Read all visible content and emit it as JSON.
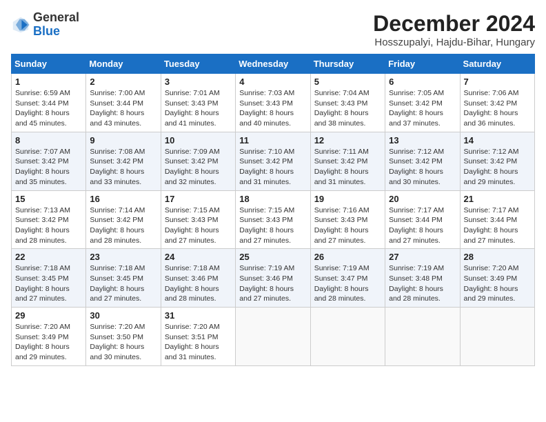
{
  "header": {
    "logo_general": "General",
    "logo_blue": "Blue",
    "main_title": "December 2024",
    "subtitle": "Hosszupalyi, Hajdu-Bihar, Hungary"
  },
  "calendar": {
    "days_of_week": [
      "Sunday",
      "Monday",
      "Tuesday",
      "Wednesday",
      "Thursday",
      "Friday",
      "Saturday"
    ],
    "weeks": [
      [
        null,
        {
          "day": "1",
          "sunrise": "6:59 AM",
          "sunset": "3:44 PM",
          "daylight": "8 hours and 45 minutes."
        },
        {
          "day": "2",
          "sunrise": "7:00 AM",
          "sunset": "3:44 PM",
          "daylight": "8 hours and 43 minutes."
        },
        {
          "day": "3",
          "sunrise": "7:01 AM",
          "sunset": "3:43 PM",
          "daylight": "8 hours and 41 minutes."
        },
        {
          "day": "4",
          "sunrise": "7:03 AM",
          "sunset": "3:43 PM",
          "daylight": "8 hours and 40 minutes."
        },
        {
          "day": "5",
          "sunrise": "7:04 AM",
          "sunset": "3:43 PM",
          "daylight": "8 hours and 38 minutes."
        },
        {
          "day": "6",
          "sunrise": "7:05 AM",
          "sunset": "3:42 PM",
          "daylight": "8 hours and 37 minutes."
        },
        {
          "day": "7",
          "sunrise": "7:06 AM",
          "sunset": "3:42 PM",
          "daylight": "8 hours and 36 minutes."
        }
      ],
      [
        {
          "day": "8",
          "sunrise": "7:07 AM",
          "sunset": "3:42 PM",
          "daylight": "8 hours and 35 minutes."
        },
        {
          "day": "9",
          "sunrise": "7:08 AM",
          "sunset": "3:42 PM",
          "daylight": "8 hours and 33 minutes."
        },
        {
          "day": "10",
          "sunrise": "7:09 AM",
          "sunset": "3:42 PM",
          "daylight": "8 hours and 32 minutes."
        },
        {
          "day": "11",
          "sunrise": "7:10 AM",
          "sunset": "3:42 PM",
          "daylight": "8 hours and 31 minutes."
        },
        {
          "day": "12",
          "sunrise": "7:11 AM",
          "sunset": "3:42 PM",
          "daylight": "8 hours and 31 minutes."
        },
        {
          "day": "13",
          "sunrise": "7:12 AM",
          "sunset": "3:42 PM",
          "daylight": "8 hours and 30 minutes."
        },
        {
          "day": "14",
          "sunrise": "7:12 AM",
          "sunset": "3:42 PM",
          "daylight": "8 hours and 29 minutes."
        }
      ],
      [
        {
          "day": "15",
          "sunrise": "7:13 AM",
          "sunset": "3:42 PM",
          "daylight": "8 hours and 28 minutes."
        },
        {
          "day": "16",
          "sunrise": "7:14 AM",
          "sunset": "3:42 PM",
          "daylight": "8 hours and 28 minutes."
        },
        {
          "day": "17",
          "sunrise": "7:15 AM",
          "sunset": "3:43 PM",
          "daylight": "8 hours and 27 minutes."
        },
        {
          "day": "18",
          "sunrise": "7:15 AM",
          "sunset": "3:43 PM",
          "daylight": "8 hours and 27 minutes."
        },
        {
          "day": "19",
          "sunrise": "7:16 AM",
          "sunset": "3:43 PM",
          "daylight": "8 hours and 27 minutes."
        },
        {
          "day": "20",
          "sunrise": "7:17 AM",
          "sunset": "3:44 PM",
          "daylight": "8 hours and 27 minutes."
        },
        {
          "day": "21",
          "sunrise": "7:17 AM",
          "sunset": "3:44 PM",
          "daylight": "8 hours and 27 minutes."
        }
      ],
      [
        {
          "day": "22",
          "sunrise": "7:18 AM",
          "sunset": "3:45 PM",
          "daylight": "8 hours and 27 minutes."
        },
        {
          "day": "23",
          "sunrise": "7:18 AM",
          "sunset": "3:45 PM",
          "daylight": "8 hours and 27 minutes."
        },
        {
          "day": "24",
          "sunrise": "7:18 AM",
          "sunset": "3:46 PM",
          "daylight": "8 hours and 28 minutes."
        },
        {
          "day": "25",
          "sunrise": "7:19 AM",
          "sunset": "3:46 PM",
          "daylight": "8 hours and 27 minutes."
        },
        {
          "day": "26",
          "sunrise": "7:19 AM",
          "sunset": "3:47 PM",
          "daylight": "8 hours and 28 minutes."
        },
        {
          "day": "27",
          "sunrise": "7:19 AM",
          "sunset": "3:48 PM",
          "daylight": "8 hours and 28 minutes."
        },
        {
          "day": "28",
          "sunrise": "7:20 AM",
          "sunset": "3:49 PM",
          "daylight": "8 hours and 29 minutes."
        }
      ],
      [
        {
          "day": "29",
          "sunrise": "7:20 AM",
          "sunset": "3:49 PM",
          "daylight": "8 hours and 29 minutes."
        },
        {
          "day": "30",
          "sunrise": "7:20 AM",
          "sunset": "3:50 PM",
          "daylight": "8 hours and 30 minutes."
        },
        {
          "day": "31",
          "sunrise": "7:20 AM",
          "sunset": "3:51 PM",
          "daylight": "8 hours and 31 minutes."
        },
        null,
        null,
        null,
        null
      ]
    ]
  }
}
